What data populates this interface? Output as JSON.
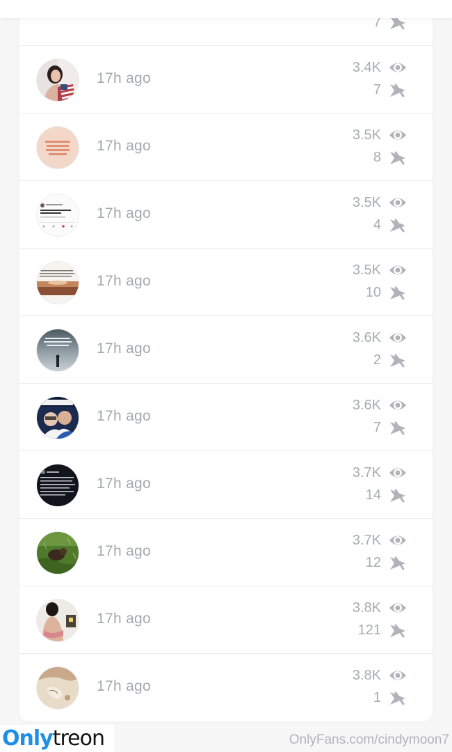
{
  "feed": {
    "partial_row": {
      "shares": "7"
    },
    "rows": [
      {
        "time": "17h ago",
        "views": "3.4K",
        "shares": "7"
      },
      {
        "time": "17h ago",
        "views": "3.5K",
        "shares": "8"
      },
      {
        "time": "17h ago",
        "views": "3.5K",
        "shares": "4"
      },
      {
        "time": "17h ago",
        "views": "3.5K",
        "shares": "10"
      },
      {
        "time": "17h ago",
        "views": "3.6K",
        "shares": "2"
      },
      {
        "time": "17h ago",
        "views": "3.6K",
        "shares": "7"
      },
      {
        "time": "17h ago",
        "views": "3.7K",
        "shares": "14"
      },
      {
        "time": "17h ago",
        "views": "3.7K",
        "shares": "12"
      },
      {
        "time": "17h ago",
        "views": "3.8K",
        "shares": "121"
      },
      {
        "time": "17h ago",
        "views": "3.8K",
        "shares": "1"
      }
    ]
  },
  "icons": {
    "views": "eye-icon",
    "shares": "share-icon"
  },
  "watermark": {
    "logo_part1": "Only",
    "logo_part2": "treon",
    "url": "OnlyFans.com/cindymoon7"
  },
  "colors": {
    "meta_text": "#a9abb3",
    "logo_blue": "#1f8ee8",
    "card_bg": "#ffffff",
    "page_bg": "#f7f7f8"
  }
}
